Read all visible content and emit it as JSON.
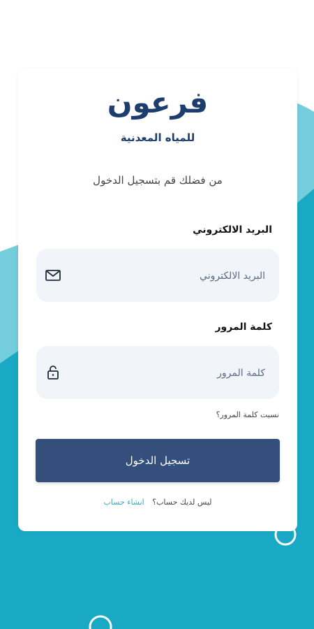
{
  "brand": {
    "title": "فرعون",
    "subtitle": "للمياه المعدنية"
  },
  "login": {
    "prompt": "من فضلك قم بتسجيل الدخول",
    "email_label": "البريد الالكتروني",
    "email_placeholder": "البريد الالكتروني",
    "password_label": "كلمة المرور",
    "password_placeholder": "كلمة المرور",
    "forgot_password": "نسيت كلمة المرور؟",
    "submit_label": "تسجيل الدخول",
    "no_account": "ليس لديك حساب؟",
    "create_account": "انشاء حساب"
  },
  "icons": {
    "email": "mail-icon",
    "password": "lock-icon"
  },
  "colors": {
    "primary": "#344f7c",
    "brand_text": "#1d3d6e",
    "teal": "#1aa9c4",
    "teal_light": "#74cddb",
    "link": "#3aa8ba",
    "field_bg": "#f1f4f8"
  }
}
